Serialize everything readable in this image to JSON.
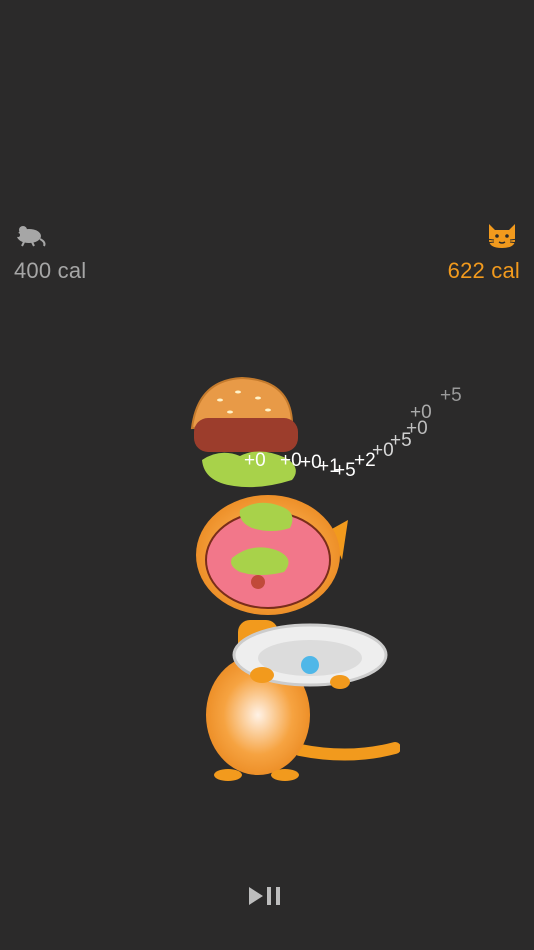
{
  "hud": {
    "player": {
      "icon": "mouse-icon",
      "calories": "400 cal",
      "color": "#a6a6a6"
    },
    "opponent": {
      "icon": "cat-face-icon",
      "calories": "622 cal",
      "color": "#f29a1d"
    }
  },
  "score_popups": [
    {
      "label": "+0"
    },
    {
      "label": "+0"
    },
    {
      "label": "+0"
    },
    {
      "label": "+1"
    },
    {
      "label": "+5"
    },
    {
      "label": "+2"
    },
    {
      "label": "+0"
    },
    {
      "label": "+5"
    },
    {
      "label": "+0"
    },
    {
      "label": "+0"
    },
    {
      "label": "+5"
    }
  ],
  "controls": {
    "play_pause": "play-pause-icon"
  },
  "colors": {
    "background": "#2b2a2a",
    "accent": "#f29a1d"
  }
}
